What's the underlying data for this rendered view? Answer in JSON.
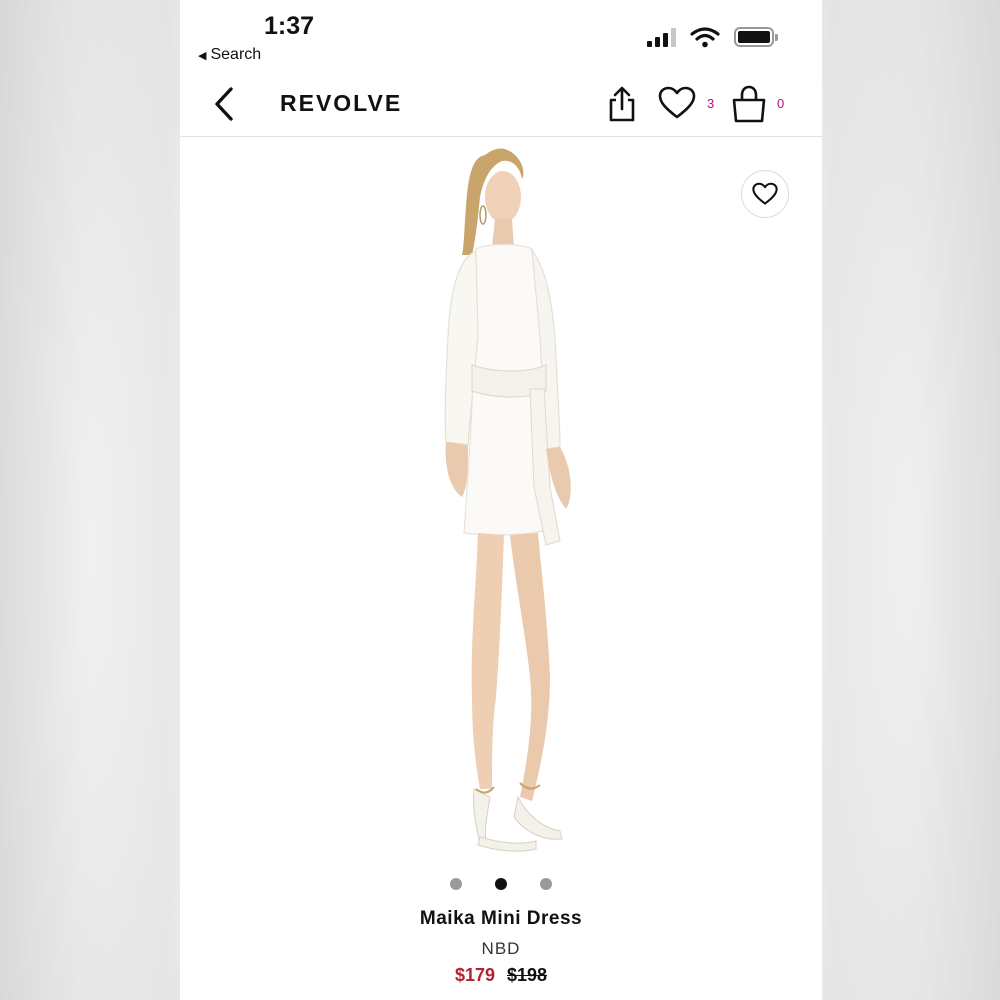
{
  "status_bar": {
    "time": "1:37",
    "back_label": "Search"
  },
  "nav": {
    "brand": "REVOLVE",
    "wishlist_count": "3",
    "bag_count": "0"
  },
  "gallery": {
    "total": 3,
    "active": 1
  },
  "product": {
    "name": "Maika Mini Dress",
    "brand": "NBD",
    "sale_price": "$179",
    "original_price": "$198"
  },
  "colors": {
    "accent_count": "#b0147a",
    "sale_price": "#b2232e"
  },
  "icons": [
    "back-chevron-icon",
    "share-icon",
    "heart-icon",
    "shopping-bag-icon",
    "wifi-icon",
    "battery-icon",
    "signal-icon"
  ]
}
